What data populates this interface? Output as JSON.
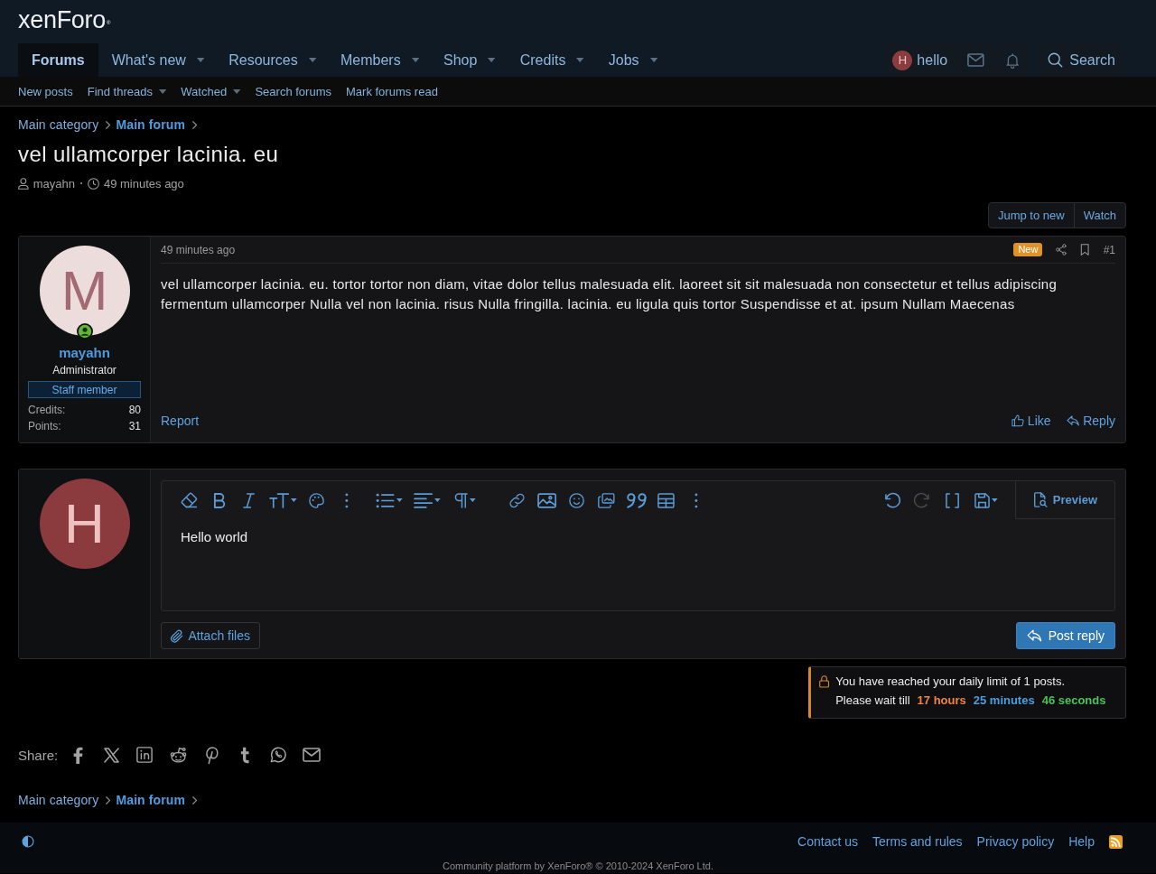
{
  "header": {
    "logo": "xenForo$^{®}$",
    "nav_tabs": [
      {
        "label": "Forums",
        "selected": true,
        "dropdown": false
      },
      {
        "label": "What's new",
        "selected": false,
        "dropdown": true
      },
      {
        "label": "Resources",
        "selected": false,
        "dropdown": true
      },
      {
        "label": "Members",
        "selected": false,
        "dropdown": true
      },
      {
        "label": "Shop",
        "selected": false,
        "dropdown": true
      },
      {
        "label": "Credits",
        "selected": false,
        "dropdown": true
      },
      {
        "label": "Jobs",
        "selected": false,
        "dropdown": true
      }
    ],
    "account": {
      "avatar_letter": "H",
      "name": "hello"
    },
    "search": "Search"
  },
  "sub_nav": [
    {
      "label": "New posts",
      "dropdown": false
    },
    {
      "label": "Find threads",
      "dropdown": true
    },
    {
      "label": "Watched",
      "dropdown": true
    },
    {
      "label": "Search forums",
      "dropdown": false
    },
    {
      "label": "Mark forums read",
      "dropdown": false
    }
  ],
  "breadcrumb": [
    {
      "label": "Main category",
      "current": false
    },
    {
      "label": "Main forum",
      "current": true
    }
  ],
  "thread": {
    "title": "vel ullamcorper lacinia. eu",
    "author": "mayahn",
    "time": "49 minutes ago",
    "buttons": [
      "Jump to new",
      "Watch"
    ]
  },
  "posts": [
    {
      "avatar_letter": "M",
      "online": true,
      "username": "mayahn",
      "role": "Administrator",
      "banner": "Staff member",
      "stats": [
        {
          "label": "Credits:",
          "value": "80"
        },
        {
          "label": "Points:",
          "value": "31"
        }
      ],
      "time": "49 minutes ago",
      "badge": "New",
      "number": "#1",
      "body": "vel ullamcorper lacinia. eu. tortor tortor non diam, vitae dolor tellus malesuada elit. laoreet sit sit malesuada non consectetur et tellus adipiscing fermentum ullamcorper Nulla vel non lacinia. risus Nulla fringilla. lacinia. eu ligula quis tortor Suspendisse et at. ipsum Nullam Maecenas",
      "report": "Report",
      "like": "Like",
      "reply": "Reply"
    }
  ],
  "quick_reply": {
    "avatar_letter": "H",
    "toolbar": {
      "groups": [
        {
          "buttons": [
            {
              "kind": "clear",
              "dropdown": false,
              "disabled": false
            },
            {
              "kind": "bold",
              "dropdown": false,
              "disabled": false
            },
            {
              "kind": "italic",
              "dropdown": false,
              "disabled": false
            },
            {
              "kind": "size",
              "dropdown": true,
              "disabled": false
            },
            {
              "kind": "color",
              "dropdown": false,
              "disabled": false
            },
            {
              "kind": "more",
              "dropdown": false,
              "disabled": false
            }
          ]
        },
        {
          "buttons": [
            {
              "kind": "list",
              "dropdown": true,
              "disabled": false
            },
            {
              "kind": "align",
              "dropdown": true,
              "disabled": false
            },
            {
              "kind": "paragraph",
              "dropdown": true,
              "disabled": false
            }
          ]
        },
        {
          "buttons": [
            {
              "kind": "link",
              "dropdown": false,
              "disabled": false
            },
            {
              "kind": "image",
              "dropdown": false,
              "disabled": false
            },
            {
              "kind": "emoji",
              "dropdown": false,
              "disabled": false
            },
            {
              "kind": "media",
              "dropdown": false,
              "disabled": false
            },
            {
              "kind": "quote",
              "dropdown": false,
              "disabled": false
            },
            {
              "kind": "table",
              "dropdown": false,
              "disabled": false
            },
            {
              "kind": "more",
              "dropdown": false,
              "disabled": false
            }
          ]
        }
      ],
      "end": [
        {
          "kind": "undo",
          "dropdown": false,
          "disabled": false
        },
        {
          "kind": "redo",
          "dropdown": false,
          "disabled": true
        },
        {
          "kind": "bbcode",
          "dropdown": false,
          "disabled": false
        },
        {
          "kind": "drafts",
          "dropdown": true,
          "disabled": false
        }
      ]
    },
    "preview": "Preview",
    "value": "Hello world",
    "attach": "Attach files",
    "submit": "Post reply"
  },
  "notice": {
    "message": "You have reached your daily limit of 1 posts.",
    "wait_label": "Please wait till",
    "countdown": [
      {
        "text": "17 hours",
        "color": "#f0843c"
      },
      {
        "text": "25 minutes",
        "color": "#4b9ee0"
      },
      {
        "text": "46 seconds",
        "color": "#4cc257"
      }
    ]
  },
  "share": {
    "label": "Share:"
  },
  "breadcrumb_bottom": [
    {
      "label": "Main category",
      "current": false
    },
    {
      "label": "Main forum",
      "current": true
    }
  ],
  "footer": {
    "links": [
      "Contact us",
      "Terms and rules",
      "Privacy policy",
      "Help"
    ],
    "copyright": "Community platform by XenForo® © 2010-2024 XenForo Ltd."
  }
}
